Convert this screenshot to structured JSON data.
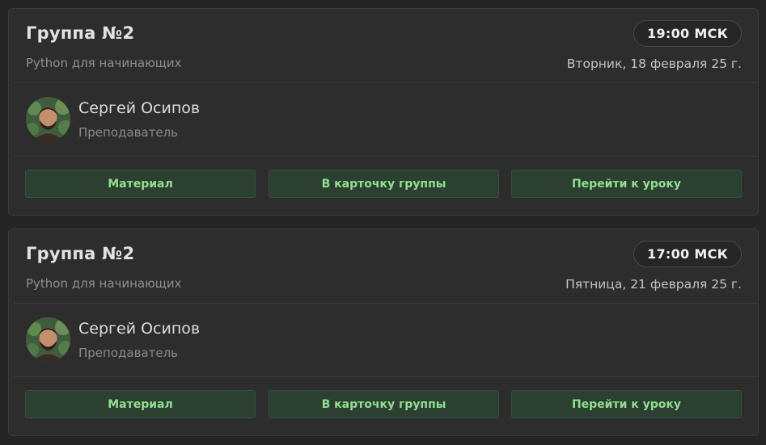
{
  "lessons": [
    {
      "title": "Группа №2",
      "subtitle": "Python для начинающих",
      "time": "19:00 МСК",
      "date": "Вторник, 18 февраля 25 г.",
      "teacher": {
        "name": "Сергей Осипов",
        "role": "Преподаватель",
        "avatar": "teacher-photo"
      },
      "buttons": {
        "material": "Материал",
        "group_card": "В карточку группы",
        "go_to_lesson": "Перейти к уроку"
      }
    },
    {
      "title": "Группа №2",
      "subtitle": "Python для начинающих",
      "time": "17:00 МСК",
      "date": "Пятница, 21 февраля 25 г.",
      "teacher": {
        "name": "Сергей Осипов",
        "role": "Преподаватель",
        "avatar": "teacher-photo"
      },
      "buttons": {
        "material": "Материал",
        "group_card": "В карточку группы",
        "go_to_lesson": "Перейти к уроку"
      }
    }
  ],
  "colors": {
    "background": "#252525",
    "card": "#2d2d2d",
    "button_bg": "#2b4030",
    "button_text": "#8fe08f"
  }
}
